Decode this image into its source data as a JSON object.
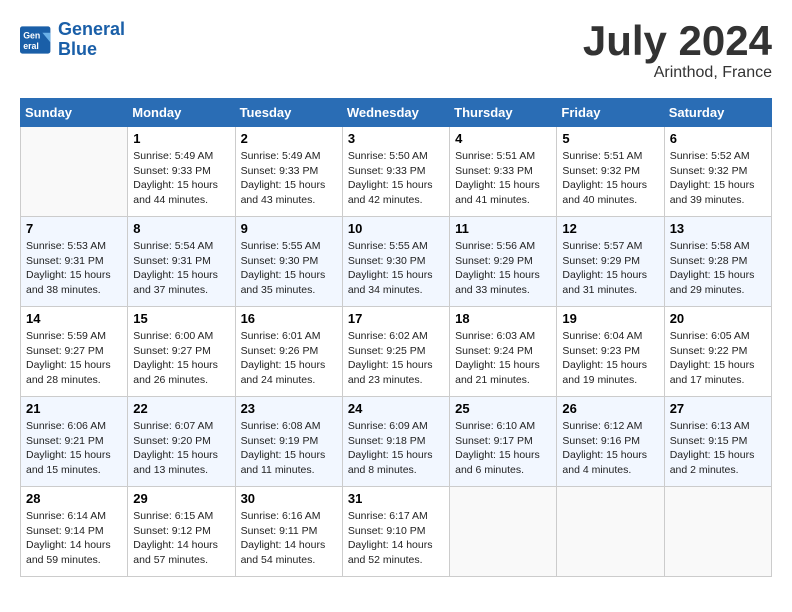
{
  "header": {
    "logo_line1": "General",
    "logo_line2": "Blue",
    "month": "July 2024",
    "location": "Arinthod, France"
  },
  "days_of_week": [
    "Sunday",
    "Monday",
    "Tuesday",
    "Wednesday",
    "Thursday",
    "Friday",
    "Saturday"
  ],
  "weeks": [
    [
      {
        "day": "",
        "info": ""
      },
      {
        "day": "1",
        "info": "Sunrise: 5:49 AM\nSunset: 9:33 PM\nDaylight: 15 hours\nand 44 minutes."
      },
      {
        "day": "2",
        "info": "Sunrise: 5:49 AM\nSunset: 9:33 PM\nDaylight: 15 hours\nand 43 minutes."
      },
      {
        "day": "3",
        "info": "Sunrise: 5:50 AM\nSunset: 9:33 PM\nDaylight: 15 hours\nand 42 minutes."
      },
      {
        "day": "4",
        "info": "Sunrise: 5:51 AM\nSunset: 9:33 PM\nDaylight: 15 hours\nand 41 minutes."
      },
      {
        "day": "5",
        "info": "Sunrise: 5:51 AM\nSunset: 9:32 PM\nDaylight: 15 hours\nand 40 minutes."
      },
      {
        "day": "6",
        "info": "Sunrise: 5:52 AM\nSunset: 9:32 PM\nDaylight: 15 hours\nand 39 minutes."
      }
    ],
    [
      {
        "day": "7",
        "info": "Sunrise: 5:53 AM\nSunset: 9:31 PM\nDaylight: 15 hours\nand 38 minutes."
      },
      {
        "day": "8",
        "info": "Sunrise: 5:54 AM\nSunset: 9:31 PM\nDaylight: 15 hours\nand 37 minutes."
      },
      {
        "day": "9",
        "info": "Sunrise: 5:55 AM\nSunset: 9:30 PM\nDaylight: 15 hours\nand 35 minutes."
      },
      {
        "day": "10",
        "info": "Sunrise: 5:55 AM\nSunset: 9:30 PM\nDaylight: 15 hours\nand 34 minutes."
      },
      {
        "day": "11",
        "info": "Sunrise: 5:56 AM\nSunset: 9:29 PM\nDaylight: 15 hours\nand 33 minutes."
      },
      {
        "day": "12",
        "info": "Sunrise: 5:57 AM\nSunset: 9:29 PM\nDaylight: 15 hours\nand 31 minutes."
      },
      {
        "day": "13",
        "info": "Sunrise: 5:58 AM\nSunset: 9:28 PM\nDaylight: 15 hours\nand 29 minutes."
      }
    ],
    [
      {
        "day": "14",
        "info": "Sunrise: 5:59 AM\nSunset: 9:27 PM\nDaylight: 15 hours\nand 28 minutes."
      },
      {
        "day": "15",
        "info": "Sunrise: 6:00 AM\nSunset: 9:27 PM\nDaylight: 15 hours\nand 26 minutes."
      },
      {
        "day": "16",
        "info": "Sunrise: 6:01 AM\nSunset: 9:26 PM\nDaylight: 15 hours\nand 24 minutes."
      },
      {
        "day": "17",
        "info": "Sunrise: 6:02 AM\nSunset: 9:25 PM\nDaylight: 15 hours\nand 23 minutes."
      },
      {
        "day": "18",
        "info": "Sunrise: 6:03 AM\nSunset: 9:24 PM\nDaylight: 15 hours\nand 21 minutes."
      },
      {
        "day": "19",
        "info": "Sunrise: 6:04 AM\nSunset: 9:23 PM\nDaylight: 15 hours\nand 19 minutes."
      },
      {
        "day": "20",
        "info": "Sunrise: 6:05 AM\nSunset: 9:22 PM\nDaylight: 15 hours\nand 17 minutes."
      }
    ],
    [
      {
        "day": "21",
        "info": "Sunrise: 6:06 AM\nSunset: 9:21 PM\nDaylight: 15 hours\nand 15 minutes."
      },
      {
        "day": "22",
        "info": "Sunrise: 6:07 AM\nSunset: 9:20 PM\nDaylight: 15 hours\nand 13 minutes."
      },
      {
        "day": "23",
        "info": "Sunrise: 6:08 AM\nSunset: 9:19 PM\nDaylight: 15 hours\nand 11 minutes."
      },
      {
        "day": "24",
        "info": "Sunrise: 6:09 AM\nSunset: 9:18 PM\nDaylight: 15 hours\nand 8 minutes."
      },
      {
        "day": "25",
        "info": "Sunrise: 6:10 AM\nSunset: 9:17 PM\nDaylight: 15 hours\nand 6 minutes."
      },
      {
        "day": "26",
        "info": "Sunrise: 6:12 AM\nSunset: 9:16 PM\nDaylight: 15 hours\nand 4 minutes."
      },
      {
        "day": "27",
        "info": "Sunrise: 6:13 AM\nSunset: 9:15 PM\nDaylight: 15 hours\nand 2 minutes."
      }
    ],
    [
      {
        "day": "28",
        "info": "Sunrise: 6:14 AM\nSunset: 9:14 PM\nDaylight: 14 hours\nand 59 minutes."
      },
      {
        "day": "29",
        "info": "Sunrise: 6:15 AM\nSunset: 9:12 PM\nDaylight: 14 hours\nand 57 minutes."
      },
      {
        "day": "30",
        "info": "Sunrise: 6:16 AM\nSunset: 9:11 PM\nDaylight: 14 hours\nand 54 minutes."
      },
      {
        "day": "31",
        "info": "Sunrise: 6:17 AM\nSunset: 9:10 PM\nDaylight: 14 hours\nand 52 minutes."
      },
      {
        "day": "",
        "info": ""
      },
      {
        "day": "",
        "info": ""
      },
      {
        "day": "",
        "info": ""
      }
    ]
  ]
}
